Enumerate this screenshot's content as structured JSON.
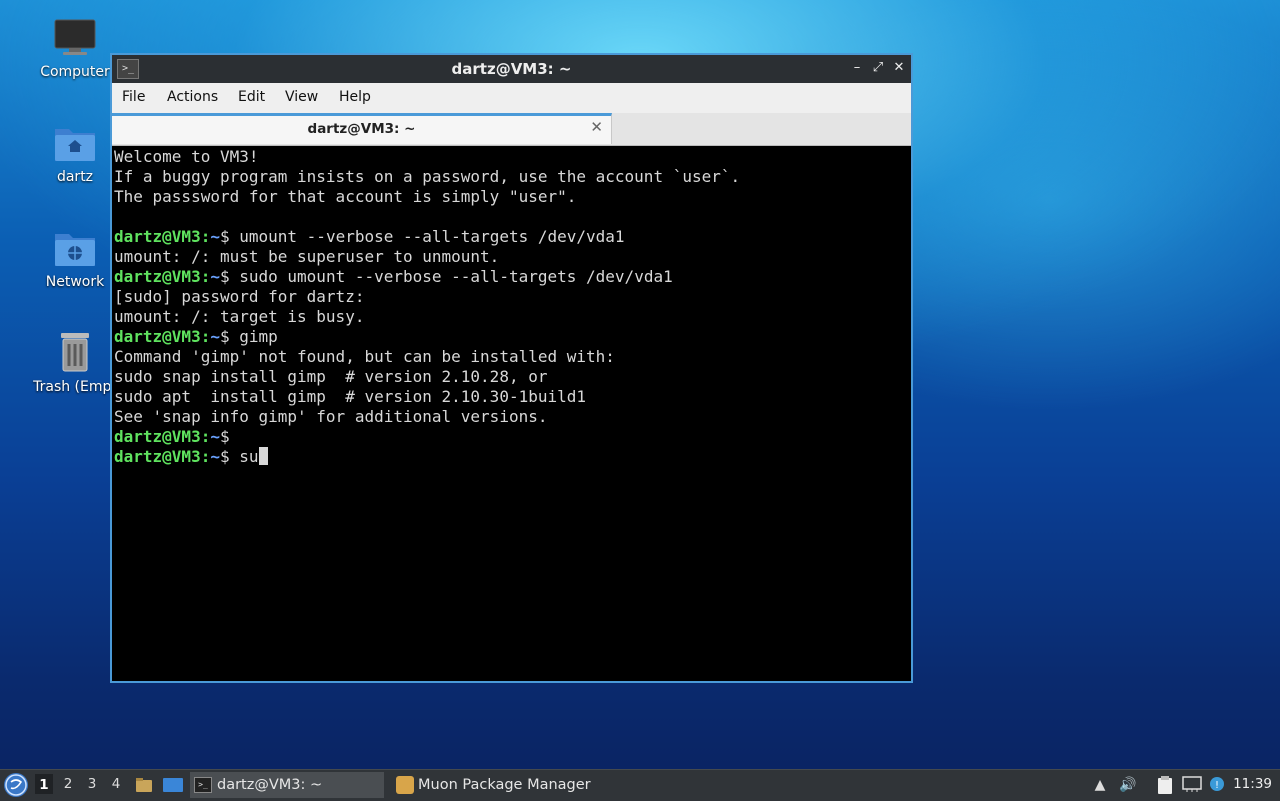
{
  "desktop": {
    "icons": [
      {
        "label": "Computer",
        "icon": "monitor-icon"
      },
      {
        "label": "dartz",
        "icon": "home-folder-icon"
      },
      {
        "label": "Network",
        "icon": "network-folder-icon"
      },
      {
        "label": "Trash (Empt",
        "icon": "trash-icon"
      }
    ]
  },
  "window": {
    "title": "dartz@VM3: ~",
    "controls": {
      "minimize": "–",
      "maximize": "⤢",
      "close": "✕"
    },
    "menu": [
      "File",
      "Actions",
      "Edit",
      "View",
      "Help"
    ],
    "tab": {
      "label": "dartz@VM3: ~",
      "close": "✕"
    }
  },
  "terminal": {
    "prompt_user": "dartz@VM3",
    "prompt_sep": ":",
    "prompt_path": "~",
    "prompt_end": "$",
    "lines": [
      {
        "type": "out",
        "text": "Welcome to VM3!"
      },
      {
        "type": "out",
        "text": "If a buggy program insists on a password, use the account `user`."
      },
      {
        "type": "out",
        "text": "The passsword for that account is simply \"user\"."
      },
      {
        "type": "out",
        "text": ""
      },
      {
        "type": "cmd",
        "text": " umount --verbose --all-targets /dev/vda1"
      },
      {
        "type": "out",
        "text": "umount: /: must be superuser to unmount."
      },
      {
        "type": "cmd",
        "text": " sudo umount --verbose --all-targets /dev/vda1"
      },
      {
        "type": "out",
        "text": "[sudo] password for dartz:"
      },
      {
        "type": "out",
        "text": "umount: /: target is busy."
      },
      {
        "type": "cmd",
        "text": " gimp"
      },
      {
        "type": "out",
        "text": "Command 'gimp' not found, but can be installed with:"
      },
      {
        "type": "out",
        "text": "sudo snap install gimp  # version 2.10.28, or"
      },
      {
        "type": "out",
        "text": "sudo apt  install gimp  # version 2.10.30-1build1"
      },
      {
        "type": "out",
        "text": "See 'snap info gimp' for additional versions."
      },
      {
        "type": "cmd",
        "text": ""
      },
      {
        "type": "input",
        "text": " su"
      }
    ]
  },
  "taskbar": {
    "workspaces": [
      "1",
      "2",
      "3",
      "4"
    ],
    "active_workspace": "1",
    "tasks": [
      {
        "label": "dartz@VM3: ~",
        "icon": "terminal-icon",
        "active": true
      },
      {
        "label": "Muon Package Manager",
        "icon": "package-manager-icon",
        "active": false
      }
    ],
    "clock": "11:39"
  }
}
